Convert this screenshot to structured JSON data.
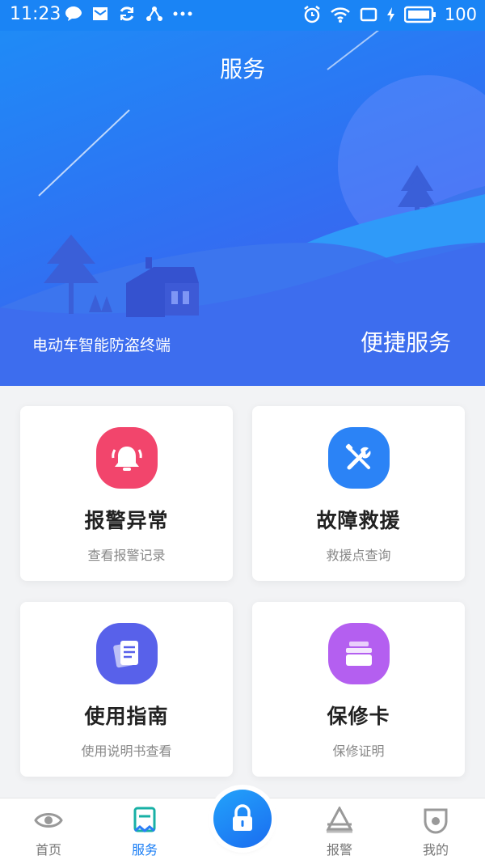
{
  "status_bar": {
    "time": "11:23",
    "battery": "100",
    "left_icons": [
      "chat-bubble-icon",
      "mail-icon",
      "sync-icon",
      "share-icon",
      "more-dots-icon"
    ],
    "right_icons": [
      "alarm-clock-icon",
      "wifi-icon",
      "screen-icon",
      "charging-icon",
      "battery-icon"
    ]
  },
  "header": {
    "title": "服务"
  },
  "hero": {
    "subtitle": "电动车智能防盗终端",
    "tagline": "便捷服务"
  },
  "services": [
    {
      "title": "报警异常",
      "subtitle": "查看报警记录",
      "icon": "alarm-bell-icon",
      "color": "#f2456c"
    },
    {
      "title": "故障救援",
      "subtitle": "救援点查询",
      "icon": "repair-tools-icon",
      "color": "#2b83f6"
    },
    {
      "title": "使用指南",
      "subtitle": "使用说明书查看",
      "icon": "guide-document-icon",
      "color": "#5861ea"
    },
    {
      "title": "保修卡",
      "subtitle": "保修证明",
      "icon": "warranty-card-icon",
      "color": "#b45ff0"
    }
  ],
  "bottom_nav": {
    "items": [
      {
        "label": "首页",
        "icon": "eye-icon",
        "active": false
      },
      {
        "label": "服务",
        "icon": "service-bookmark-icon",
        "active": true
      },
      {
        "label": "报警",
        "icon": "alarm-triangle-icon",
        "active": false
      },
      {
        "label": "我的",
        "icon": "profile-shield-icon",
        "active": false
      }
    ],
    "center_icon": "lock-icon"
  },
  "colors": {
    "accent": "#1a7ef5",
    "hero_start": "#1d8ef7",
    "hero_end": "#4658ec"
  }
}
